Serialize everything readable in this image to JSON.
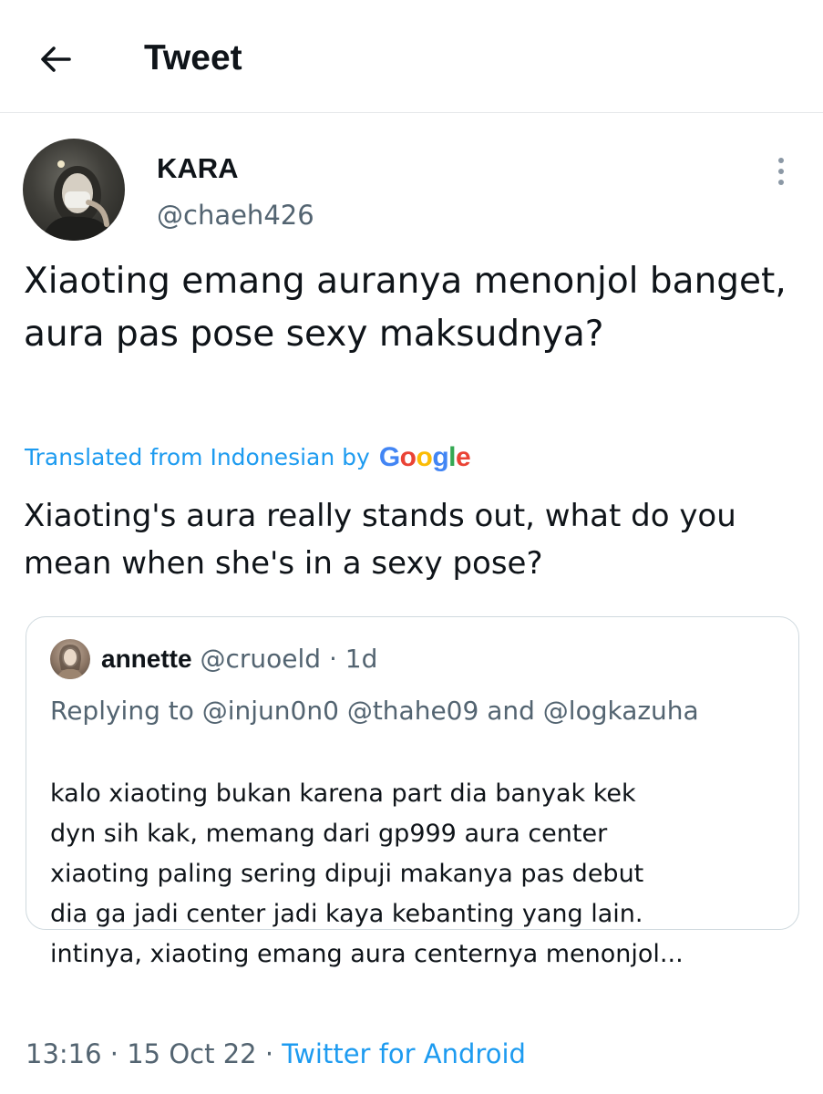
{
  "header": {
    "title": "Tweet"
  },
  "author": {
    "name": "KARA",
    "handle": "@chaeh426"
  },
  "tweet": {
    "text": "Xiaoting emang auranya menonjol banget, aura pas pose sexy maksudnya?",
    "translated_label": "Translated from Indonesian by",
    "google_letters": [
      {
        "ch": "G",
        "color": "#4285f4"
      },
      {
        "ch": "o",
        "color": "#ea4335"
      },
      {
        "ch": "o",
        "color": "#fbbc05"
      },
      {
        "ch": "g",
        "color": "#4285f4"
      },
      {
        "ch": "l",
        "color": "#34a853"
      },
      {
        "ch": "e",
        "color": "#ea4335"
      }
    ],
    "translation": "Xiaoting's aura really stands out, what do you mean when she's in a sexy pose?"
  },
  "quote": {
    "name": "annette",
    "handle": "@cruoeld",
    "separator": "·",
    "time": "1d",
    "replying": "Replying to @injun0n0 @thahe09 and @logkazuha",
    "body_lines": [
      "kalo xiaoting bukan karena part dia banyak kek",
      "dyn sih kak, memang dari gp999 aura center",
      "xiaoting paling sering dipuji makanya pas debut",
      "dia ga jadi center jadi kaya kebanting yang lain.",
      "intinya, xiaoting emang aura centernya menonjol..."
    ]
  },
  "meta": {
    "time": "13:16",
    "sep1": "·",
    "date": "15 Oct 22",
    "sep2": "·",
    "source": "Twitter for Android"
  },
  "colors": {
    "link": "#1d9bf0",
    "secondary_text": "#536471",
    "primary_text": "#0f1419",
    "border": "#cfd9de"
  },
  "icons": {
    "back": "arrow-left-icon",
    "more": "more-vertical-icon"
  }
}
